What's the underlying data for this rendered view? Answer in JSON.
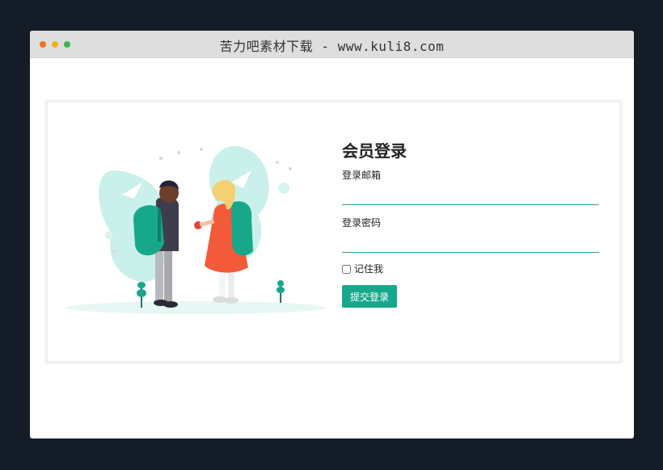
{
  "window": {
    "title": "苦力吧素材下载 - www.kuli8.com",
    "dot_colors": [
      "#f2711c",
      "#e9b616",
      "#3bb84d"
    ]
  },
  "login": {
    "heading": "会员登录",
    "email_label": "登录邮箱",
    "email_value": "",
    "password_label": "登录密码",
    "password_value": "",
    "remember_label": "记住我",
    "remember_checked": false,
    "submit_label": "提交登录"
  },
  "colors": {
    "accent": "#17a88c",
    "illustration_mint": "#c9f0ea",
    "girl_dress": "#f25a3a",
    "backpack": "#17a88c",
    "background": "#141c27"
  }
}
